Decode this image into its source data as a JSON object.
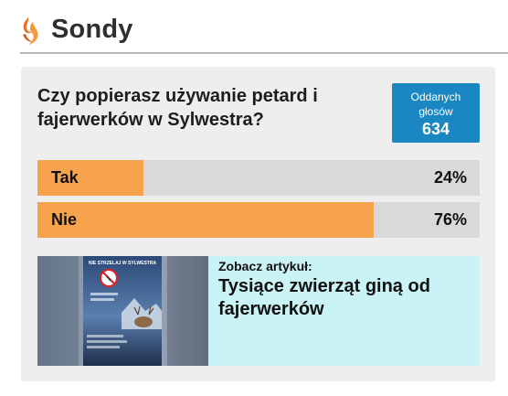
{
  "section": {
    "title": "Sondy"
  },
  "poll": {
    "question": "Czy popierasz używanie petard i fajerwerków w Sylwestra?",
    "votes_label": "Oddanych głosów",
    "votes_count": "634",
    "options": [
      {
        "label": "Tak",
        "percent_text": "24%",
        "percent": 24
      },
      {
        "label": "Nie",
        "percent_text": "76%",
        "percent": 76
      }
    ],
    "bar_fill_color": "#f7a24d",
    "bar_track_color": "#d9d9d9",
    "votes_badge_color": "#1a87c2"
  },
  "related_article": {
    "kicker": "Zobacz artykuł:",
    "title": "Tysiące zwierząt giną od fajerwerków",
    "thumbnail": {
      "heading": "NIE STRZELAJ W SYLWESTRA",
      "icon": "no-fireworks-icon"
    },
    "background_color": "#c9f3f5"
  }
}
